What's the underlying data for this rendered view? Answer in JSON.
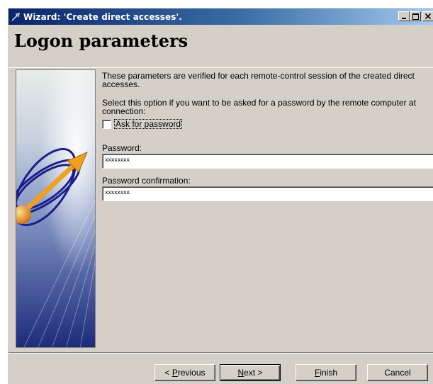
{
  "window": {
    "title": "Wizard: 'Create direct accesses'.",
    "buttons": {
      "minimize": "_",
      "maximize": "□",
      "close": "×"
    }
  },
  "page": {
    "title": "Logon parameters"
  },
  "content": {
    "description": "These parameters are verified for each remote-control session of the created direct accesses.",
    "option_description": "Select this option if you want to be asked for a password by the remote computer at connection:",
    "ask_password": {
      "label": "Ask for password",
      "checked": false
    },
    "password": {
      "label": "Password:",
      "value": "xxxxxxxx"
    },
    "password_confirmation": {
      "label": "Password confirmation:",
      "value": "xxxxxxxx"
    }
  },
  "footer": {
    "previous": {
      "prefix": "< ",
      "accel": "P",
      "rest": "revious"
    },
    "next": {
      "accel": "N",
      "rest": "ext >"
    },
    "finish": {
      "accel": "F",
      "rest": "inish"
    },
    "cancel": "Cancel"
  },
  "colors": {
    "title_bar_start": "#0a246a",
    "title_bar_end": "#a6caf0",
    "dialog_bg": "#d4d0c8",
    "sidebar_dark": "#1c2a7a",
    "arrow": "#f0a020"
  }
}
